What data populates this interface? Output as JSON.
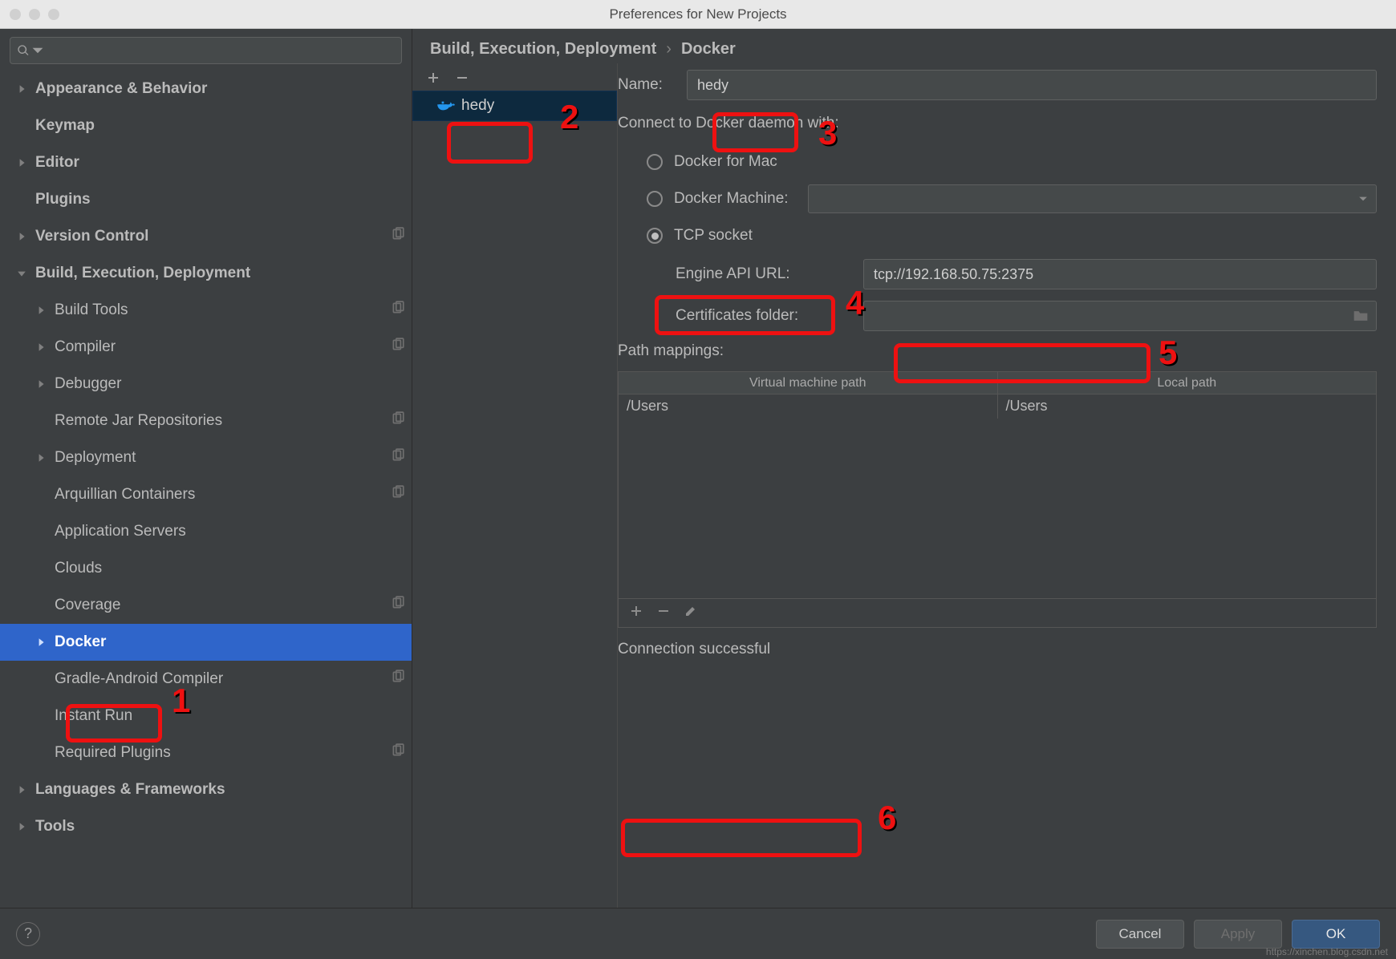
{
  "window": {
    "title": "Preferences for New Projects"
  },
  "search": {
    "placeholder": ""
  },
  "sidebar": [
    {
      "label": "Appearance & Behavior",
      "bold": true,
      "arrow": "right",
      "indent": 0
    },
    {
      "label": "Keymap",
      "bold": true,
      "indent": 0
    },
    {
      "label": "Editor",
      "bold": true,
      "arrow": "right",
      "indent": 0
    },
    {
      "label": "Plugins",
      "bold": true,
      "indent": 0
    },
    {
      "label": "Version Control",
      "bold": true,
      "arrow": "right",
      "indent": 0,
      "copy": true
    },
    {
      "label": "Build, Execution, Deployment",
      "bold": true,
      "arrow": "down",
      "indent": 0
    },
    {
      "label": "Build Tools",
      "arrow": "right",
      "indent": 1,
      "copy": true
    },
    {
      "label": "Compiler",
      "arrow": "right",
      "indent": 1,
      "copy": true
    },
    {
      "label": "Debugger",
      "arrow": "right",
      "indent": 1
    },
    {
      "label": "Remote Jar Repositories",
      "indent": 1,
      "copy": true
    },
    {
      "label": "Deployment",
      "arrow": "right",
      "indent": 1,
      "copy": true
    },
    {
      "label": "Arquillian Containers",
      "indent": 1,
      "copy": true
    },
    {
      "label": "Application Servers",
      "indent": 1
    },
    {
      "label": "Clouds",
      "indent": 1
    },
    {
      "label": "Coverage",
      "indent": 1,
      "copy": true
    },
    {
      "label": "Docker",
      "arrow": "right",
      "indent": 1,
      "selected": true
    },
    {
      "label": "Gradle-Android Compiler",
      "indent": 1,
      "copy": true
    },
    {
      "label": "Instant Run",
      "indent": 1
    },
    {
      "label": "Required Plugins",
      "indent": 1,
      "copy": true
    },
    {
      "label": "Languages & Frameworks",
      "bold": true,
      "arrow": "right",
      "indent": 0
    },
    {
      "label": "Tools",
      "bold": true,
      "arrow": "right",
      "indent": 0
    }
  ],
  "breadcrumb": {
    "parent": "Build, Execution, Deployment",
    "current": "Docker"
  },
  "midList": {
    "items": [
      {
        "label": "hedy"
      }
    ]
  },
  "form": {
    "nameLabel": "Name:",
    "nameValue": "hedy",
    "connectLabel": "Connect to Docker daemon with:",
    "radios": {
      "mac": "Docker for Mac",
      "machine": "Docker Machine:",
      "tcp": "TCP socket"
    },
    "engineUrlLabel": "Engine API URL:",
    "engineUrlValue": "tcp://192.168.50.75:2375",
    "certLabel": "Certificates folder:",
    "certValue": "",
    "pathMappingsLabel": "Path mappings:",
    "table": {
      "headers": {
        "vm": "Virtual machine path",
        "local": "Local path"
      },
      "rows": [
        {
          "vm": "/Users",
          "local": "/Users"
        }
      ]
    },
    "status": "Connection successful"
  },
  "footer": {
    "cancel": "Cancel",
    "apply": "Apply",
    "ok": "OK"
  },
  "annotations": {
    "1": "1",
    "2": "2",
    "3": "3",
    "4": "4",
    "5": "5",
    "6": "6"
  },
  "watermark": "https://xinchen.blog.csdn.net"
}
